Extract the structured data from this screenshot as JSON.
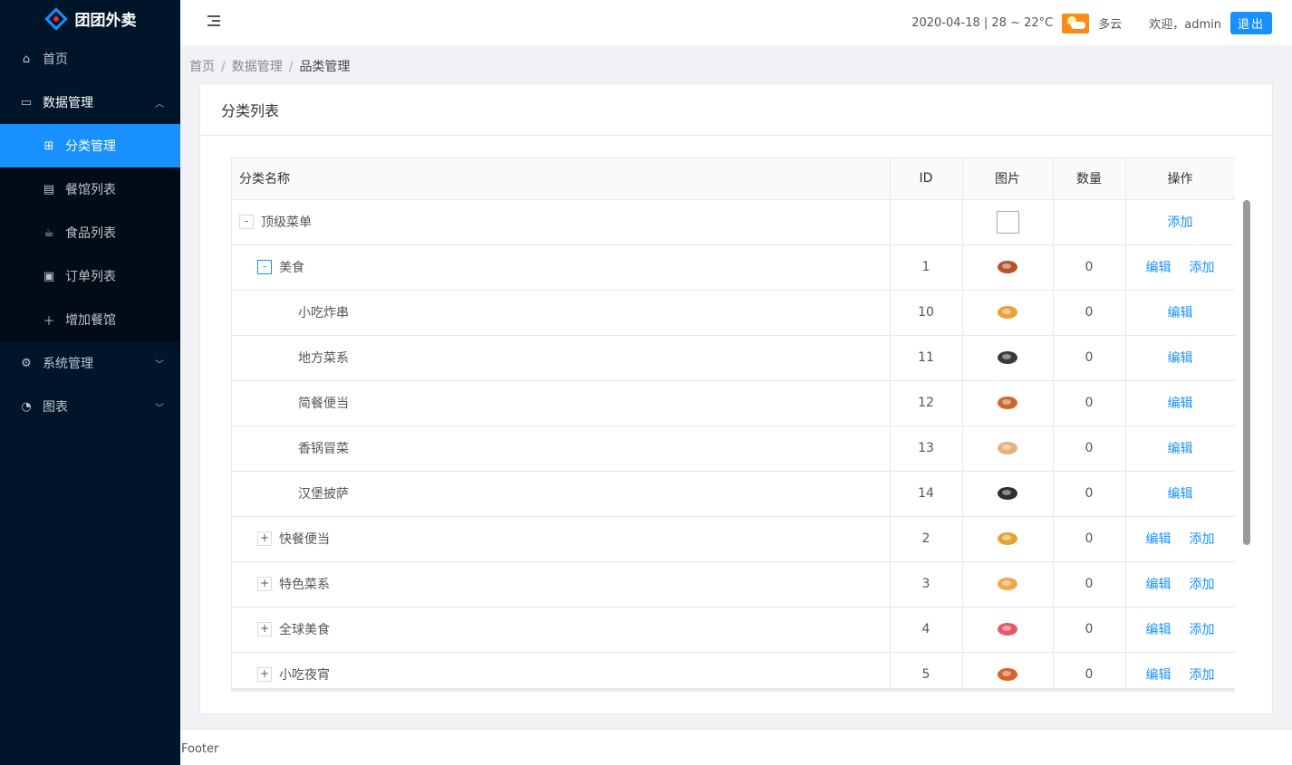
{
  "app": {
    "name": "团团外卖"
  },
  "sidebar": {
    "items": [
      {
        "label": "首页",
        "icon": "home-icon"
      },
      {
        "label": "数据管理",
        "icon": "laptop-icon",
        "open": true,
        "children": [
          {
            "label": "分类管理",
            "icon": "appstore-icon",
            "active": true
          },
          {
            "label": "餐馆列表",
            "icon": "shop-icon"
          },
          {
            "label": "食品列表",
            "icon": "coffee-icon"
          },
          {
            "label": "订单列表",
            "icon": "order-icon"
          },
          {
            "label": "增加餐馆",
            "icon": "plus-icon"
          }
        ]
      },
      {
        "label": "系统管理",
        "icon": "setting-icon"
      },
      {
        "label": "图表",
        "icon": "pie-chart-icon"
      }
    ]
  },
  "header": {
    "weather_text": "2020-04-18 | 28 ~ 22°C",
    "weather_desc": "多云",
    "welcome": "欢迎，admin",
    "logout_label": "退出",
    "accent_color": "#1890ff"
  },
  "breadcrumb": [
    "首页",
    "数据管理",
    "品类管理"
  ],
  "card": {
    "title": "分类列表"
  },
  "table": {
    "columns": [
      "分类名称",
      "ID",
      "图片",
      "数量",
      "操作"
    ],
    "rows": [
      {
        "name": "顶级菜单",
        "level": 0,
        "expander": "-",
        "id": "",
        "image": "empty",
        "count": "",
        "actions": [
          "添加"
        ]
      },
      {
        "name": "美食",
        "level": 1,
        "expander": "-",
        "id": "1",
        "image": "food",
        "count": "0",
        "actions": [
          "编辑",
          "添加"
        ]
      },
      {
        "name": "小吃炸串",
        "level": 2,
        "expander": "",
        "id": "10",
        "image": "food",
        "count": "0",
        "actions": [
          "编辑"
        ]
      },
      {
        "name": "地方菜系",
        "level": 2,
        "expander": "",
        "id": "11",
        "image": "food",
        "count": "0",
        "actions": [
          "编辑"
        ]
      },
      {
        "name": "简餐便当",
        "level": 2,
        "expander": "",
        "id": "12",
        "image": "food",
        "count": "0",
        "actions": [
          "编辑"
        ]
      },
      {
        "name": "香锅冒菜",
        "level": 2,
        "expander": "",
        "id": "13",
        "image": "food",
        "count": "0",
        "actions": [
          "编辑"
        ]
      },
      {
        "name": "汉堡披萨",
        "level": 2,
        "expander": "",
        "id": "14",
        "image": "food",
        "count": "0",
        "actions": [
          "编辑"
        ]
      },
      {
        "name": "快餐便当",
        "level": 1,
        "expander": "+",
        "id": "2",
        "image": "food",
        "count": "0",
        "actions": [
          "编辑",
          "添加"
        ]
      },
      {
        "name": "特色菜系",
        "level": 1,
        "expander": "+",
        "id": "3",
        "image": "food",
        "count": "0",
        "actions": [
          "编辑",
          "添加"
        ]
      },
      {
        "name": "全球美食",
        "level": 1,
        "expander": "+",
        "id": "4",
        "image": "food",
        "count": "0",
        "actions": [
          "编辑",
          "添加"
        ]
      },
      {
        "name": "小吃夜宵",
        "level": 1,
        "expander": "+",
        "id": "5",
        "image": "food",
        "count": "0",
        "actions": [
          "编辑",
          "添加"
        ]
      }
    ]
  },
  "footer": {
    "text": "Footer"
  }
}
